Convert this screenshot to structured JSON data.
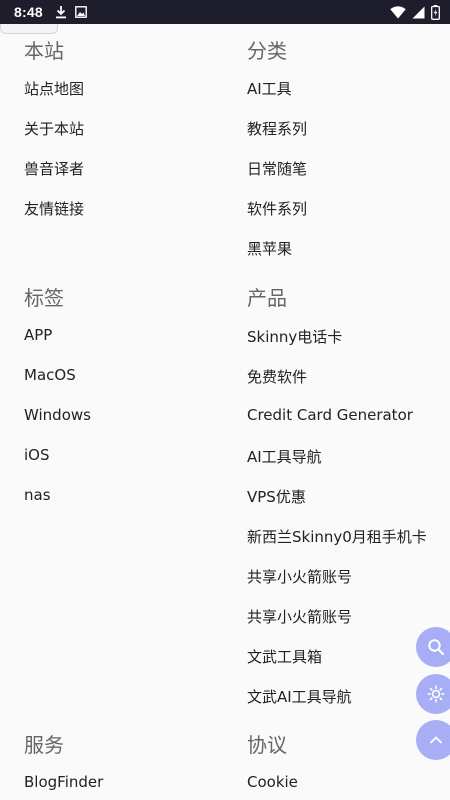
{
  "status_bar": {
    "time": "8:48",
    "icons": [
      "download-icon",
      "image-icon",
      "wifi-icon",
      "signal-icon",
      "battery-charging-icon"
    ]
  },
  "sections": {
    "site": {
      "title": "本站",
      "links": [
        "站点地图",
        "关于本站",
        "兽音译者",
        "友情链接"
      ]
    },
    "categories": {
      "title": "分类",
      "links": [
        "AI工具",
        "教程系列",
        "日常随笔",
        "软件系列",
        "黑苹果"
      ]
    },
    "tags": {
      "title": "标签",
      "links": [
        "APP",
        "MacOS",
        "Windows",
        "iOS",
        "nas"
      ]
    },
    "products": {
      "title": "产品",
      "links": [
        "Skinny电话卡",
        "免费软件",
        "Credit Card Generator",
        "AI工具导航",
        "VPS优惠",
        "新西兰Skinny0月租手机卡",
        "共享小火箭账号",
        "共享小火箭账号",
        "文武工具箱",
        "文武AI工具导航"
      ]
    },
    "services": {
      "title": "服务",
      "links": [
        "BlogFinder"
      ]
    },
    "agreements": {
      "title": "协议",
      "links": [
        "Cookie"
      ]
    }
  },
  "floating_buttons": [
    "search-icon",
    "sun-icon",
    "chevron-up-icon"
  ],
  "colors": {
    "status_bar_bg": "#1d1d2b",
    "background": "#fafafa",
    "fab_bg": "#a7aef5",
    "heading": "#666666",
    "link": "#222222"
  }
}
